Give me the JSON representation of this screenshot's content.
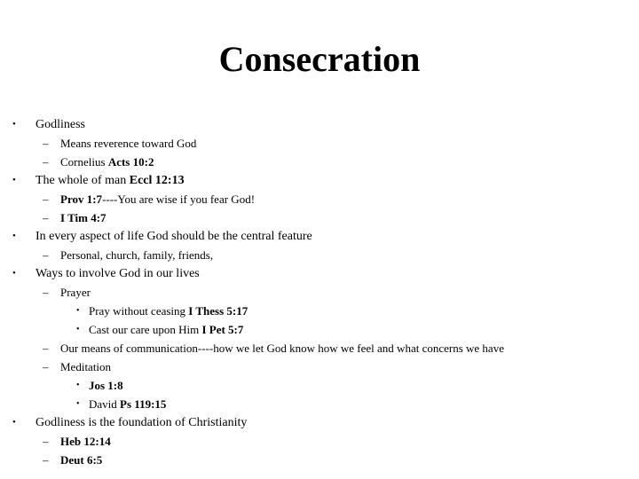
{
  "slide": {
    "title": "Consecration",
    "background_color": "#ffffff",
    "text_color": "#000000",
    "bullet_glyph_level1": "•",
    "bullet_glyph_level2": "–",
    "bullet_glyph_level3": "•",
    "lines": [
      {
        "level": 1,
        "marker": "•",
        "segments": [
          {
            "text": "Godliness",
            "bold": false
          }
        ]
      },
      {
        "level": 2,
        "marker": "–",
        "segments": [
          {
            "text": "Means reverence toward God",
            "bold": false
          }
        ]
      },
      {
        "level": 2,
        "marker": "–",
        "segments": [
          {
            "text": "Cornelius ",
            "bold": false
          },
          {
            "text": "Acts 10:2",
            "bold": true
          }
        ]
      },
      {
        "level": 1,
        "marker": "•",
        "segments": [
          {
            "text": "The whole of man ",
            "bold": false
          },
          {
            "text": "Eccl 12:13",
            "bold": true
          }
        ]
      },
      {
        "level": 2,
        "marker": "–",
        "segments": [
          {
            "text": "Prov 1:7",
            "bold": true
          },
          {
            "text": "----You are wise if you fear God!",
            "bold": false
          }
        ]
      },
      {
        "level": 2,
        "marker": "–",
        "segments": [
          {
            "text": "I Tim 4:7",
            "bold": true
          }
        ]
      },
      {
        "level": 1,
        "marker": "•",
        "segments": [
          {
            "text": "In every aspect of life God should be the central feature",
            "bold": false
          }
        ]
      },
      {
        "level": 2,
        "marker": "–",
        "segments": [
          {
            "text": "Personal, church, family, friends,",
            "bold": false
          }
        ]
      },
      {
        "level": 1,
        "marker": "•",
        "segments": [
          {
            "text": "Ways to involve God in our lives",
            "bold": false
          }
        ]
      },
      {
        "level": 2,
        "marker": "–",
        "segments": [
          {
            "text": "Prayer",
            "bold": false
          }
        ]
      },
      {
        "level": 3,
        "marker": "•",
        "segments": [
          {
            "text": "Pray without ceasing ",
            "bold": false
          },
          {
            "text": "I Thess 5:17",
            "bold": true
          }
        ]
      },
      {
        "level": 3,
        "marker": "•",
        "segments": [
          {
            "text": "Cast our care upon Him ",
            "bold": false
          },
          {
            "text": "I Pet 5:7",
            "bold": true
          }
        ]
      },
      {
        "level": 2,
        "marker": "–",
        "segments": [
          {
            "text": "Our means of communication----how we let God know how we feel and what concerns we have",
            "bold": false
          }
        ]
      },
      {
        "level": 2,
        "marker": "–",
        "segments": [
          {
            "text": "Meditation",
            "bold": false
          }
        ]
      },
      {
        "level": 3,
        "marker": "•",
        "segments": [
          {
            "text": "Jos 1:8",
            "bold": true
          }
        ]
      },
      {
        "level": 3,
        "marker": "•",
        "segments": [
          {
            "text": "David ",
            "bold": false
          },
          {
            "text": "Ps 119:15",
            "bold": true
          }
        ]
      },
      {
        "level": 1,
        "marker": "•",
        "segments": [
          {
            "text": "Godliness is the foundation of Christianity",
            "bold": false
          }
        ]
      },
      {
        "level": 2,
        "marker": "–",
        "segments": [
          {
            "text": "Heb 12:14",
            "bold": true
          }
        ]
      },
      {
        "level": 2,
        "marker": "–",
        "segments": [
          {
            "text": "Deut 6:5",
            "bold": true
          }
        ]
      }
    ]
  }
}
